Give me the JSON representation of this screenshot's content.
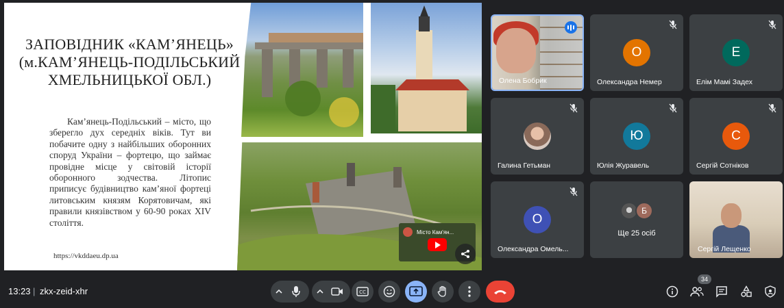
{
  "slide": {
    "title": "ЗАПОВІДНИК «КАМ’ЯНЕЦЬ» (м.КАМ’ЯНЕЦЬ-ПОДІЛЬСЬКИЙ ХМЕЛЬНИЦЬКОЇ ОБЛ.)",
    "body": "Кам’янець-Подільський – місто, що зберегло дух середніх віків. Тут ви побачите одну з найбільших оборонних споруд України – фортецю, що займає провідне місце у світовій історії оборонного зодчества. Літопис приписує будівництво кам’яної фортеці литовським князям Корятовичам, які правили князівством у 60-90 роках XIV століття.",
    "url": "https://vkddaeu.dp.ua",
    "video_title": "Місто Кам'ян..."
  },
  "participants": [
    {
      "name": "Олена Бобрик",
      "state": "speaking"
    },
    {
      "name": "Олександра Немер",
      "initial": "О",
      "color": "#e37400"
    },
    {
      "name": "Елім Мамі Задех",
      "initial": "Е",
      "color": "#00695c"
    },
    {
      "name": "Галина Гетьман",
      "state": "photo"
    },
    {
      "name": "Юлія Журавель",
      "initial": "Ю",
      "color": "#12799b"
    },
    {
      "name": "Сергій Сотніков",
      "initial": "С",
      "color": "#e8590c"
    },
    {
      "name": "Олександра Омель...",
      "initial": "О",
      "color": "#3f51b5"
    },
    {
      "name": "Ще 25 осіб",
      "initial": "Б"
    },
    {
      "name": "Сергій Лещенко",
      "state": "camera"
    }
  ],
  "bar": {
    "time": "13:23",
    "separator": "|",
    "meeting_code": "zkx-zeid-xhr",
    "people_count": "34"
  },
  "colors": {
    "background": "#202124",
    "tile": "#3c4043",
    "present_active": "#8ab4f8",
    "end_call": "#ea4335"
  }
}
